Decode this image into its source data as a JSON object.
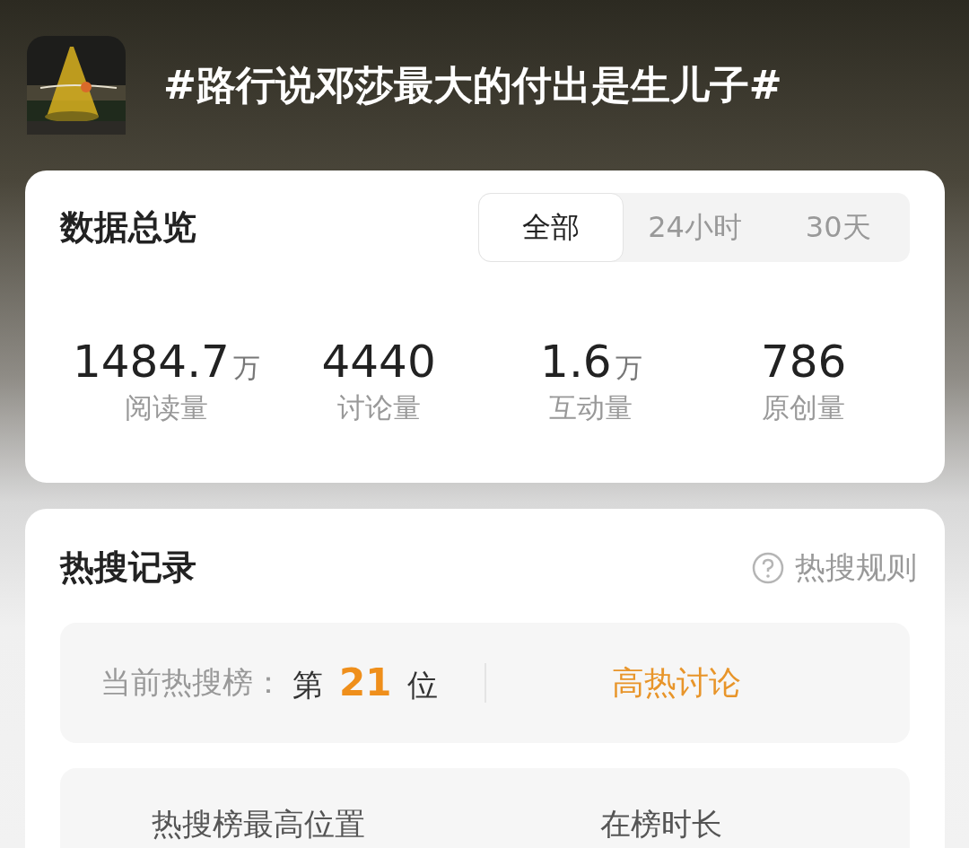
{
  "header": {
    "title": "#路行说邓莎最大的付出是生儿子#"
  },
  "overview": {
    "title": "数据总览",
    "tabs": [
      {
        "label": "全部",
        "selected": true
      },
      {
        "label": "24小时",
        "selected": false
      },
      {
        "label": "30天",
        "selected": false
      }
    ],
    "stats": [
      {
        "value": "1484.7",
        "unit": "万",
        "label": "阅读量"
      },
      {
        "value": "4440",
        "label": "讨论量"
      },
      {
        "value": "1.6",
        "unit": "万",
        "label": "互动量"
      },
      {
        "value": "786",
        "label": "原创量"
      }
    ]
  },
  "hot_search": {
    "title": "热搜记录",
    "rules_link": "热搜规则",
    "current": {
      "label": "当前热搜榜：",
      "prefix": "第",
      "rank": "21",
      "suffix": "位",
      "tag": "高热讨论"
    },
    "bottom_labels": [
      "热搜榜最高位置",
      "在榜时长"
    ]
  }
}
